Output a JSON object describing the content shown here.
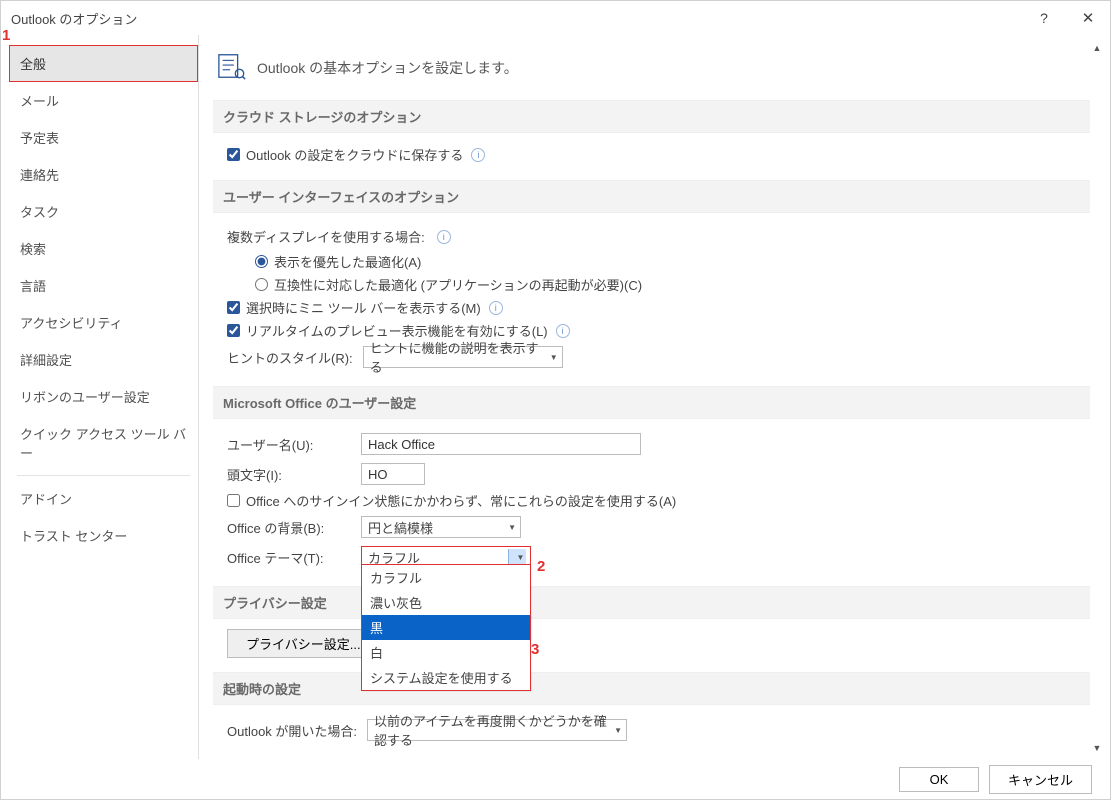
{
  "titlebar": {
    "title": "Outlook のオプション",
    "help": "?",
    "close": "✕"
  },
  "sidebar": {
    "items": [
      "全般",
      "メール",
      "予定表",
      "連絡先",
      "タスク",
      "検索",
      "言語",
      "アクセシビリティ",
      "詳細設定",
      "リボンのユーザー設定",
      "クイック アクセス ツール バー",
      "アドイン",
      "トラスト センター"
    ]
  },
  "page_heading": "Outlook の基本オプションを設定します。",
  "sections": {
    "cloud": {
      "title": "クラウド ストレージのオプション",
      "save_to_cloud": "Outlook の設定をクラウドに保存する"
    },
    "ui": {
      "title": "ユーザー インターフェイスのオプション",
      "multi_display_label": "複数ディスプレイを使用する場合:",
      "radio_opt_display": "表示を優先した最適化(A)",
      "radio_opt_compat": "互換性に対応した最適化 (アプリケーションの再起動が必要)(C)",
      "mini_toolbar": "選択時にミニ ツール バーを表示する(M)",
      "live_preview": "リアルタイムのプレビュー表示機能を有効にする(L)",
      "hint_style_label": "ヒントのスタイル(R):",
      "hint_style_value": "ヒントに機能の説明を表示する"
    },
    "office": {
      "title": "Microsoft Office のユーザー設定",
      "username_label": "ユーザー名(U):",
      "username_value": "Hack Office",
      "initials_label": "頭文字(I):",
      "initials_value": "HO",
      "always_use": "Office へのサインイン状態にかかわらず、常にこれらの設定を使用する(A)",
      "background_label": "Office の背景(B):",
      "background_value": "円と縞模様",
      "theme_label": "Office テーマ(T):",
      "theme_value": "カラフル",
      "theme_options": [
        "カラフル",
        "濃い灰色",
        "黒",
        "白",
        "システム設定を使用する"
      ]
    },
    "privacy": {
      "title": "プライバシー設定",
      "button": "プライバシー設定..."
    },
    "startup": {
      "title": "起動時の設定",
      "label": "Outlook が開いた場合:",
      "value": "以前のアイテムを再度開くかどうかを確認する"
    }
  },
  "footer": {
    "ok": "OK",
    "cancel": "キャンセル"
  },
  "annotations": {
    "1": "1",
    "2": "2",
    "3": "3"
  }
}
